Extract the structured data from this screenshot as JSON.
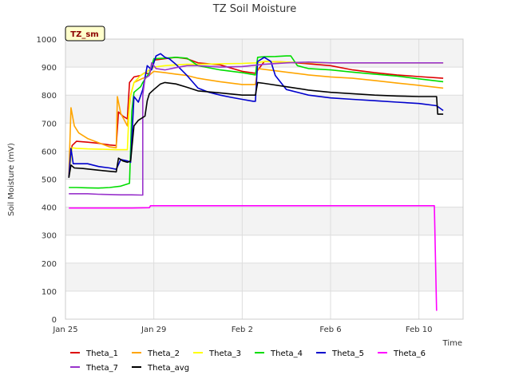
{
  "chart_data": {
    "type": "line",
    "title": "TZ Soil Moisture",
    "badge": "TZ_sm",
    "xlabel": "Time",
    "ylabel": "Soil Moisture (mV)",
    "xlim": [
      0,
      18
    ],
    "ylim": [
      0,
      1000
    ],
    "x_ticks": [
      {
        "x": 0,
        "label": "Jan 25"
      },
      {
        "x": 4,
        "label": "Jan 29"
      },
      {
        "x": 8,
        "label": "Feb 2"
      },
      {
        "x": 12,
        "label": "Feb 6"
      },
      {
        "x": 16,
        "label": "Feb 10"
      }
    ],
    "y_ticks": [
      0,
      100,
      200,
      300,
      400,
      500,
      600,
      700,
      800,
      900,
      1000
    ],
    "grid": true,
    "legend_position": "bottom",
    "series": [
      {
        "name": "Theta_1",
        "color": "#dd0000",
        "x": [
          0.15,
          0.3,
          0.5,
          1.0,
          1.5,
          2.0,
          2.3,
          2.4,
          2.6,
          2.8,
          2.9,
          3.1,
          3.4,
          3.6,
          3.8,
          4.0,
          4.5,
          5.0,
          5.5,
          6.0,
          7.0,
          8.0,
          8.6,
          9.0,
          10.0,
          11.0,
          12.0,
          13.0,
          14.0,
          15.0,
          16.0,
          17.1
        ],
        "y": [
          510,
          620,
          635,
          632,
          628,
          622,
          620,
          740,
          725,
          715,
          845,
          865,
          870,
          880,
          875,
          925,
          930,
          935,
          930,
          915,
          908,
          885,
          878,
          920,
          918,
          912,
          905,
          890,
          880,
          872,
          866,
          860
        ]
      },
      {
        "name": "Theta_2",
        "color": "#ffa500",
        "x": [
          0.15,
          0.25,
          0.4,
          0.6,
          1.0,
          1.5,
          2.0,
          2.3,
          2.35,
          2.5,
          2.8,
          2.95,
          3.1,
          3.5,
          3.7,
          4.0,
          4.5,
          5.0,
          5.5,
          6.0,
          7.0,
          8.0,
          8.6,
          8.7,
          9.0,
          10.0,
          11.0,
          12.0,
          13.0,
          14.0,
          15.0,
          16.0,
          17.1
        ],
        "y": [
          510,
          755,
          690,
          665,
          645,
          630,
          615,
          612,
          795,
          735,
          690,
          800,
          845,
          860,
          865,
          885,
          880,
          875,
          870,
          860,
          848,
          838,
          838,
          895,
          892,
          882,
          872,
          865,
          860,
          852,
          843,
          835,
          825
        ]
      },
      {
        "name": "Theta_3",
        "color": "#ffff00",
        "x": [
          0.15,
          0.3,
          0.5,
          1.0,
          1.5,
          2.0,
          2.3,
          2.8,
          2.9,
          3.1,
          3.4,
          3.7,
          4.0,
          4.5,
          5.0,
          5.5,
          6.0,
          7.0,
          8.0,
          8.6,
          9.0,
          10.0,
          11.0,
          12.0,
          13.0,
          14.0,
          15.0,
          16.0,
          17.1
        ],
        "y": [
          505,
          612,
          610,
          608,
          607,
          606,
          605,
          605,
          780,
          845,
          870,
          885,
          900,
          905,
          908,
          910,
          910,
          912,
          913,
          915,
          920,
          918,
          916,
          915,
          915,
          915,
          915,
          915,
          915
        ]
      },
      {
        "name": "Theta_4",
        "color": "#00dd00",
        "x": [
          0.15,
          0.5,
          1.0,
          1.5,
          2.0,
          2.5,
          2.9,
          3.0,
          3.1,
          3.4,
          3.5,
          3.8,
          4.0,
          4.5,
          5.0,
          5.5,
          6.0,
          7.0,
          8.0,
          8.6,
          8.7,
          9.0,
          9.5,
          10.0,
          10.2,
          10.5,
          11.0,
          12.0,
          13.0,
          14.0,
          15.0,
          16.0,
          17.1
        ],
        "y": [
          470,
          470,
          469,
          468,
          470,
          475,
          485,
          740,
          810,
          830,
          845,
          880,
          930,
          932,
          935,
          932,
          905,
          890,
          880,
          872,
          935,
          937,
          938,
          940,
          940,
          905,
          895,
          890,
          882,
          875,
          868,
          858,
          848
        ]
      },
      {
        "name": "Theta_5",
        "color": "#0000cc",
        "x": [
          0.15,
          0.25,
          0.35,
          0.6,
          1.0,
          1.5,
          2.0,
          2.3,
          2.5,
          2.8,
          2.95,
          3.1,
          3.3,
          3.5,
          3.7,
          3.9,
          4.1,
          4.3,
          4.5,
          4.7,
          5.0,
          5.5,
          6.0,
          6.5,
          7.0,
          7.5,
          8.0,
          8.5,
          8.6,
          8.7,
          9.0,
          9.3,
          9.5,
          10.0,
          11.0,
          12.0,
          13.0,
          14.0,
          15.0,
          16.0,
          16.8,
          17.1
        ],
        "y": [
          505,
          610,
          555,
          555,
          555,
          545,
          540,
          535,
          570,
          565,
          560,
          795,
          775,
          820,
          905,
          890,
          940,
          948,
          935,
          930,
          910,
          870,
          825,
          810,
          800,
          792,
          785,
          778,
          778,
          920,
          935,
          920,
          870,
          820,
          800,
          790,
          785,
          780,
          775,
          770,
          762,
          745
        ]
      },
      {
        "name": "Theta_6",
        "color": "#ff00ff",
        "x": [
          0.15,
          1.0,
          2.0,
          3.0,
          3.8,
          3.85,
          5.0,
          6.0,
          8.0,
          10.0,
          12.0,
          14.0,
          16.0,
          16.7,
          16.8
        ],
        "y": [
          397,
          397,
          397,
          397,
          398,
          405,
          405,
          405,
          405,
          405,
          405,
          405,
          405,
          405,
          30
        ]
      },
      {
        "name": "Theta_7",
        "color": "#9933cc",
        "x": [
          0.15,
          0.5,
          1.0,
          1.5,
          2.0,
          2.5,
          3.0,
          3.5,
          3.5,
          3.6,
          3.8,
          3.9,
          4.1,
          4.5,
          5.0,
          5.5,
          6.0,
          7.0,
          8.0,
          9.0,
          10.0,
          11.0,
          12.0,
          13.0,
          14.0,
          15.0,
          16.0,
          17.1
        ],
        "y": [
          448,
          448,
          448,
          446,
          445,
          444,
          444,
          443,
          800,
          860,
          870,
          915,
          895,
          890,
          898,
          905,
          905,
          900,
          902,
          910,
          915,
          918,
          915,
          915,
          915,
          915,
          915,
          915
        ]
      },
      {
        "name": "Theta_avg",
        "color": "#000000",
        "x": [
          0.15,
          0.25,
          0.4,
          0.8,
          1.5,
          2.0,
          2.3,
          2.4,
          2.6,
          2.8,
          2.95,
          3.1,
          3.3,
          3.6,
          3.7,
          3.8,
          4.0,
          4.3,
          4.5,
          5.0,
          5.5,
          6.0,
          7.0,
          8.0,
          8.6,
          8.7,
          9.0,
          10.0,
          11.0,
          12.0,
          13.0,
          14.0,
          15.0,
          16.0,
          16.8,
          16.85,
          17.1
        ],
        "y": [
          505,
          550,
          540,
          538,
          532,
          528,
          526,
          575,
          565,
          560,
          565,
          690,
          710,
          725,
          780,
          805,
          820,
          840,
          845,
          840,
          828,
          815,
          808,
          800,
          800,
          845,
          842,
          830,
          818,
          810,
          805,
          800,
          797,
          795,
          795,
          732,
          732
        ]
      }
    ]
  }
}
